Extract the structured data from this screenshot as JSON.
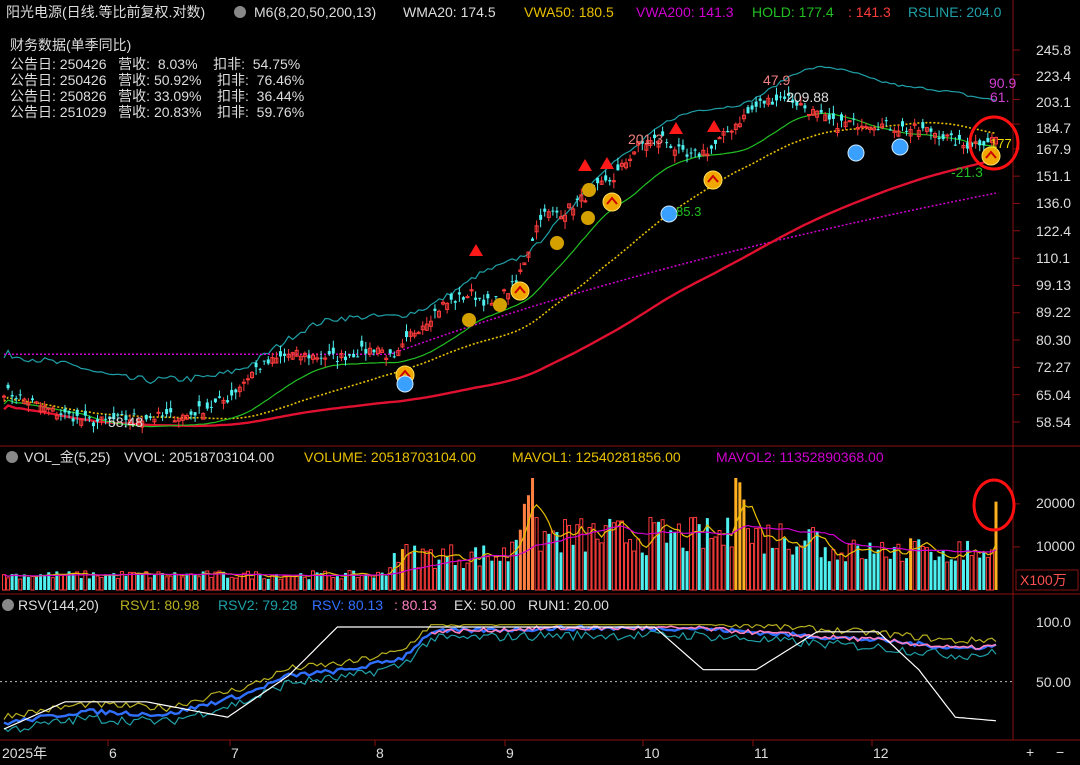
{
  "header": {
    "stock": "阳光电源(日线.等比前复权.对数)",
    "params": "M6(8,20,50,200,13)",
    "wma20": "WMA20: 174.5",
    "vwa50": "VWA50: 180.5",
    "vwa200": "VWA200: 141.3",
    "hold": "HOLD: 177.4",
    "hold2": ": 141.3",
    "rsline": "RSLINE: 204.0"
  },
  "finance": {
    "title": "财务数据(单季同比)",
    "rows": [
      "公告日: 250426   营收:  8.03%    扣非:  54.75%",
      "公告日: 250426   营收: 50.92%    扣非:  76.46%",
      "公告日: 250826   营收: 33.09%    扣非:  36.44%",
      "公告日: 251029   营收: 20.83%    扣非:  59.76%"
    ]
  },
  "annotations": {
    "low": "58.48",
    "high": "209.88",
    "a1": "201.3",
    "a2": "47.9",
    "a3": "90.9",
    "a4": "61.",
    "a5": "-21.3",
    "a6": "177",
    "a7": "85.3"
  },
  "price_axis": [
    "245.8",
    "223.4",
    "203.1",
    "184.7",
    "167.9",
    "151.1",
    "136.0",
    "122.4",
    "110.1",
    "99.13",
    "89.22",
    "80.30",
    "72.27",
    "65.04",
    "58.54"
  ],
  "vol_header": {
    "name": "VOL_金(5,25)",
    "vvol": "VVOL: 20518703104.00",
    "volume": "VOLUME: 20518703104.00",
    "mavol1": "MAVOL1: 12540281856.00",
    "mavol2": "MAVOL2: 11352890368.00"
  },
  "vol_axis": [
    "20000",
    "10000"
  ],
  "vol_unit": "X100万",
  "rsv_header": {
    "name": "RSV(144,20)",
    "rsv1": "RSV1: 80.98",
    "rsv2": "RSV2: 79.28",
    "rsv": "RSV: 80.13",
    "rsv_b": ": 80.13",
    "ex": "EX: 50.00",
    "run1": "RUN1: 20.00"
  },
  "rsv_axis": [
    "100.0",
    "50.00"
  ],
  "x_axis": [
    "2025年",
    "6",
    "7",
    "8",
    "9",
    "10",
    "11",
    "12"
  ],
  "buttons": {
    "plus": "+",
    "minus": "−"
  },
  "colors": {
    "bg": "#000000",
    "up": "#ff3b3b",
    "down": "#4ff0f0",
    "wma": "#22c022",
    "vwa50": "#e8c000",
    "vwa200": "#d000d0",
    "hold": "#22c022",
    "rsline": "#1fa0a8",
    "ma_red": "#e01030"
  },
  "chart_data": {
    "type": "candlestick",
    "x_ticks": [
      "2025年",
      "6",
      "7",
      "8",
      "9",
      "10",
      "11",
      "12"
    ],
    "price_close_keypoints": [
      [
        0,
        66
      ],
      [
        12,
        61
      ],
      [
        22,
        58.5
      ],
      [
        32,
        59.5
      ],
      [
        45,
        60
      ],
      [
        55,
        64
      ],
      [
        62,
        72
      ],
      [
        70,
        76
      ],
      [
        82,
        75
      ],
      [
        92,
        78
      ],
      [
        96,
        74
      ],
      [
        100,
        82
      ],
      [
        108,
        92
      ],
      [
        115,
        96
      ],
      [
        120,
        92
      ],
      [
        126,
        100
      ],
      [
        132,
        130
      ],
      [
        138,
        132
      ],
      [
        143,
        140
      ],
      [
        150,
        150
      ],
      [
        156,
        170
      ],
      [
        162,
        175
      ],
      [
        168,
        162
      ],
      [
        174,
        168
      ],
      [
        180,
        185
      ],
      [
        186,
        200
      ],
      [
        192,
        206
      ],
      [
        198,
        195
      ],
      [
        204,
        185
      ],
      [
        212,
        186
      ],
      [
        220,
        182
      ],
      [
        228,
        180
      ],
      [
        236,
        170
      ],
      [
        244,
        175
      ]
    ],
    "volume_100m": {
      "max_recent": 20518.7,
      "mavol1": 12540.3,
      "mavol2": 11352.9
    },
    "rsv": {
      "rsv1": 80.98,
      "rsv2": 79.28,
      "rsv": 80.13,
      "ex": 50,
      "run1": 20
    }
  }
}
